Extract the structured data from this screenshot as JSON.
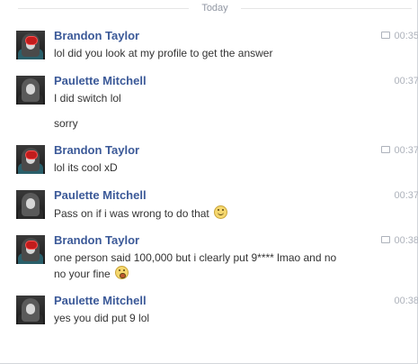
{
  "divider": {
    "label": "Today"
  },
  "messages": [
    {
      "sender": "Brandon Taylor",
      "time": "00:35",
      "lines": [
        "lol did you look at my profile to get the answer"
      ]
    },
    {
      "sender": "Paulette Mitchell",
      "time": "00:37",
      "lines": [
        "I did switch lol",
        "sorry"
      ]
    },
    {
      "sender": "Brandon Taylor",
      "time": "00:37",
      "lines": [
        "lol its cool xD"
      ]
    },
    {
      "sender": "Paulette Mitchell",
      "time": "00:37",
      "lines": [
        "Pass on if i was wrong to do that"
      ]
    },
    {
      "sender": "Brandon Taylor",
      "time": "00:38",
      "lines": [
        "one person said 100,000 but i clearly put 9**** lmao and no",
        "no your fine"
      ]
    },
    {
      "sender": "Paulette Mitchell",
      "time": "00:38",
      "lines": [
        "yes you did put 9 lol"
      ]
    }
  ],
  "icons": {
    "smile": "smile-emoticon-icon",
    "surprised": "surprised-emoticon-icon",
    "chat": "chat-bubble-icon"
  }
}
